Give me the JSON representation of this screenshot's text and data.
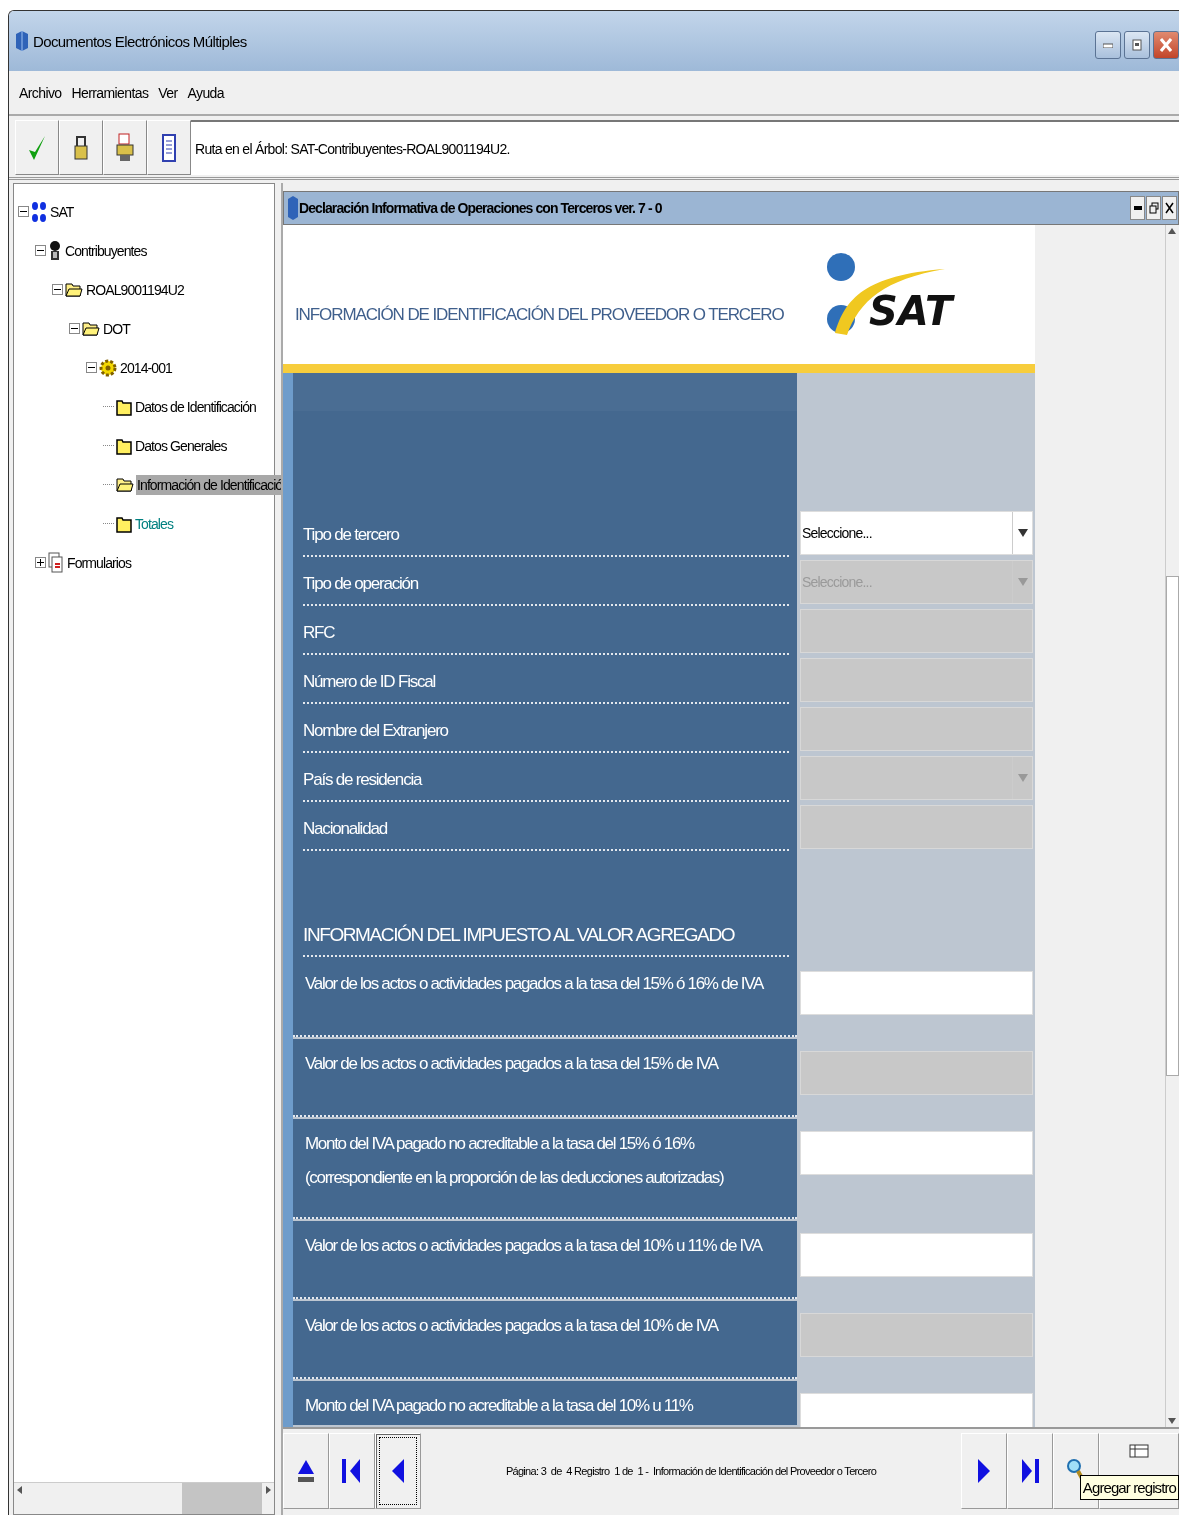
{
  "window": {
    "title": "Documentos Electrónicos Múltiples"
  },
  "menu": [
    "Archivo",
    "Herramientas",
    "Ver",
    "Ayuda"
  ],
  "path_bar": "Ruta en el Árbol: SAT-Contribuyentes-ROAL9001194U2.",
  "tree": [
    {
      "label": "SAT",
      "kind": "root",
      "expanded": true,
      "selected": false,
      "color": "#000000",
      "children": [
        {
          "label": "Contribuyentes",
          "kind": "person",
          "expanded": true,
          "selected": false,
          "color": "#000000",
          "children": [
            {
              "label": "ROAL9001194U2",
              "kind": "folder",
              "expanded": true,
              "selected": false,
              "color": "#000000",
              "children": [
                {
                  "label": "DOT",
                  "kind": "folder",
                  "expanded": true,
                  "selected": false,
                  "color": "#000000",
                  "children": [
                    {
                      "label": "2014-001",
                      "kind": "period",
                      "expanded": true,
                      "selected": false,
                      "color": "#000000",
                      "children": [
                        {
                          "label": "Datos de Identificación",
                          "kind": "leaf",
                          "selected": false,
                          "color": "#000000"
                        },
                        {
                          "label": "Datos Generales",
                          "kind": "leaf",
                          "selected": false,
                          "color": "#000000"
                        },
                        {
                          "label": "Información de Identificació",
                          "kind": "folder",
                          "selected": true,
                          "color": "#000000"
                        },
                        {
                          "label": "Totales",
                          "kind": "leaf",
                          "selected": false,
                          "color": "#008080"
                        }
                      ]
                    }
                  ]
                }
              ]
            }
          ]
        },
        {
          "label": "Formularios",
          "kind": "forms",
          "expanded": false,
          "selected": false,
          "color": "#000000"
        }
      ]
    }
  ],
  "document": {
    "title": "Declaración Informativa de Operaciones con Terceros ver. 7 - 0",
    "heading": "INFORMACIÓN DE IDENTIFICACIÓN DEL PROVEEDOR O TERCERO",
    "logo_text": "SAT",
    "fields": [
      {
        "label": "Tipo de tercero",
        "kind": "select",
        "value": "Seleccione...",
        "disabled": false
      },
      {
        "label": "Tipo de operación",
        "kind": "select",
        "value": "Seleccione...",
        "disabled": true
      },
      {
        "label": "RFC",
        "kind": "text",
        "disabled": true
      },
      {
        "label": "Número de ID Fiscal",
        "kind": "text",
        "disabled": true
      },
      {
        "label": "Nombre del Extranjero",
        "kind": "text",
        "disabled": true
      },
      {
        "label": "País de residencia",
        "kind": "select",
        "disabled": true
      },
      {
        "label": "Nacionalidad",
        "kind": "text",
        "disabled": true
      }
    ],
    "iva_heading": "INFORMACIÓN DEL IMPUESTO AL VALOR AGREGADO",
    "iva_rows": [
      {
        "label": "Valor de los actos o actividades pagados a la tasa del 15% ó 16% de IVA",
        "disabled": false
      },
      {
        "label": "Valor de los actos o actividades pagados a la tasa del 15% de IVA",
        "disabled": true
      },
      {
        "label": "Monto del IVA pagado no acreditable  a la tasa del 15% ó 16%\n(correspondiente en la proporción de las deducciones autorizadas)",
        "disabled": false
      },
      {
        "label": "Valor de los actos o actividades pagados a la tasa del 10% u 11% de IVA",
        "disabled": false
      },
      {
        "label": "Valor de los actos o actividades pagados a la tasa del 10% de IVA",
        "disabled": true
      },
      {
        "label": "Monto del IVA pagado no acreditable  a la tasa del 10% u 11%",
        "disabled": false
      }
    ]
  },
  "navigation": {
    "buttons": [
      {
        "kind": "up",
        "focused": false
      },
      {
        "kind": "first",
        "focused": false
      },
      {
        "kind": "prev",
        "focused": true
      }
    ],
    "status": "Página: 3  de  4 Registro  1 de  1 -  Información de Identificación del Proveedor o Tercero",
    "right_buttons": [
      {
        "kind": "next"
      },
      {
        "kind": "last"
      },
      {
        "kind": "search"
      },
      {
        "kind": "add"
      }
    ],
    "tooltip": "Agregar registro"
  }
}
